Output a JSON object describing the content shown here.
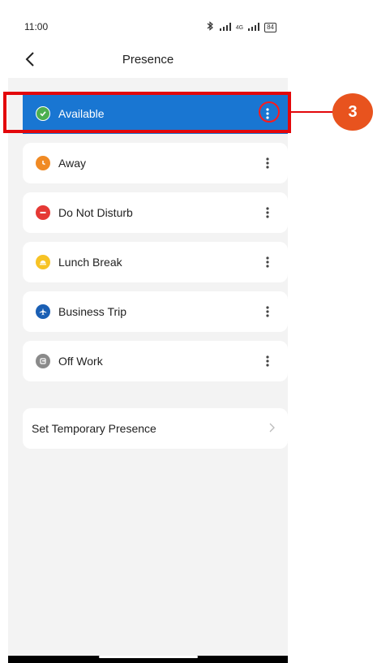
{
  "status_bar": {
    "time": "11:00",
    "network": "4G",
    "battery": "84",
    "icons": [
      "bluetooth-icon",
      "signal-icon",
      "signal-4g-icon",
      "battery-icon"
    ]
  },
  "header": {
    "title": "Presence",
    "back_icon": "chevron-left-icon"
  },
  "presence_items": [
    {
      "label": "Available",
      "icon": "check-circle-icon",
      "color": "#4caf50",
      "selected": true
    },
    {
      "label": "Away",
      "icon": "clock-icon",
      "color": "#f08a24",
      "selected": false
    },
    {
      "label": "Do Not Disturb",
      "icon": "minus-circle-icon",
      "color": "#e53935",
      "selected": false
    },
    {
      "label": "Lunch Break",
      "icon": "food-icon",
      "color": "#f7c325",
      "selected": false
    },
    {
      "label": "Business Trip",
      "icon": "plane-icon",
      "color": "#1a5fb4",
      "selected": false
    },
    {
      "label": "Off Work",
      "icon": "off-work-icon",
      "color": "#8a8a8a",
      "selected": false
    }
  ],
  "temporary": {
    "label": "Set Temporary Presence",
    "icon": "chevron-right-icon"
  },
  "annotation": {
    "number": "3",
    "color": "#e8531e",
    "box_color": "#e3070b"
  },
  "colors": {
    "selected_background": "#1976d2",
    "page_background": "#f3f3f3"
  }
}
